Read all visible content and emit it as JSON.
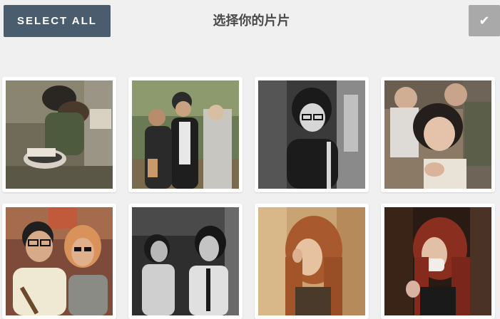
{
  "toolbar": {
    "select_all_label": "SELECT ALL",
    "title": "选择你的片片",
    "confirm_icon": "checkmark-icon",
    "confirm_glyph": "✔"
  },
  "colors": {
    "select_all_bg": "#4a5d6e",
    "confirm_bg": "#a9a9a9",
    "page_bg": "#f0f0f0",
    "tile_bg": "#ffffff"
  },
  "photos": [
    {
      "id": "photo-1",
      "subject": "person-in-fur-hat-sitting"
    },
    {
      "id": "photo-2",
      "subject": "two-men-on-street"
    },
    {
      "id": "photo-3",
      "subject": "woman-with-glasses-bw"
    },
    {
      "id": "photo-4",
      "subject": "woman-with-bob-hair"
    },
    {
      "id": "photo-5",
      "subject": "couple-with-glasses"
    },
    {
      "id": "photo-6",
      "subject": "two-women-bw"
    },
    {
      "id": "photo-7",
      "subject": "woman-with-long-brown-hair"
    },
    {
      "id": "photo-8",
      "subject": "woman-with-mask-red-hair"
    }
  ]
}
